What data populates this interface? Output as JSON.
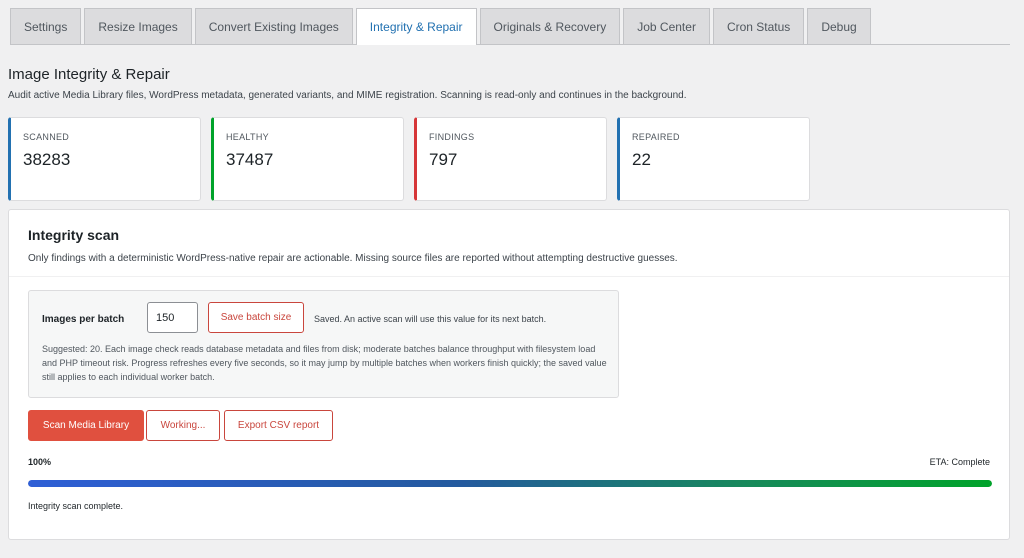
{
  "tabs": [
    {
      "label": "Settings",
      "active": false
    },
    {
      "label": "Resize Images",
      "active": false
    },
    {
      "label": "Convert Existing Images",
      "active": false
    },
    {
      "label": "Integrity & Repair",
      "active": true
    },
    {
      "label": "Originals & Recovery",
      "active": false
    },
    {
      "label": "Job Center",
      "active": false
    },
    {
      "label": "Cron Status",
      "active": false
    },
    {
      "label": "Debug",
      "active": false
    }
  ],
  "page": {
    "title": "Image Integrity & Repair",
    "description": "Audit active Media Library files, WordPress metadata, generated variants, and MIME registration. Scanning is read-only and continues in the background."
  },
  "stats": [
    {
      "label": "SCANNED",
      "value": "38283",
      "color": "#2271b1"
    },
    {
      "label": "HEALTHY",
      "value": "37487",
      "color": "#00a32a"
    },
    {
      "label": "FINDINGS",
      "value": "797",
      "color": "#d63638"
    },
    {
      "label": "REPAIRED",
      "value": "22",
      "color": "#2271b1"
    }
  ],
  "scan": {
    "title": "Integrity scan",
    "description": "Only findings with a deterministic WordPress-native repair are actionable. Missing source files are reported without attempting destructive guesses.",
    "batch_label": "Images per batch",
    "batch_value": "150",
    "save_label": "Save batch size",
    "saved_note": "Saved. An active scan will use this value for its next batch.",
    "suggestion": "Suggested: 20. Each image check reads database metadata and files from disk; moderate batches balance throughput with filesystem load and PHP timeout risk. Progress refreshes every five seconds, so it may jump by multiple batches when workers finish quickly; the saved value still applies to each individual worker batch.",
    "scan_button": "Scan Media Library",
    "working_button": "Working...",
    "export_button": "Export CSV report",
    "progress_label": "100%",
    "progress_fraction": 1.0,
    "eta": "ETA: Complete",
    "status": "Integrity scan complete."
  },
  "colors": {
    "accent": "#e0503f",
    "link": "#2271b1"
  }
}
